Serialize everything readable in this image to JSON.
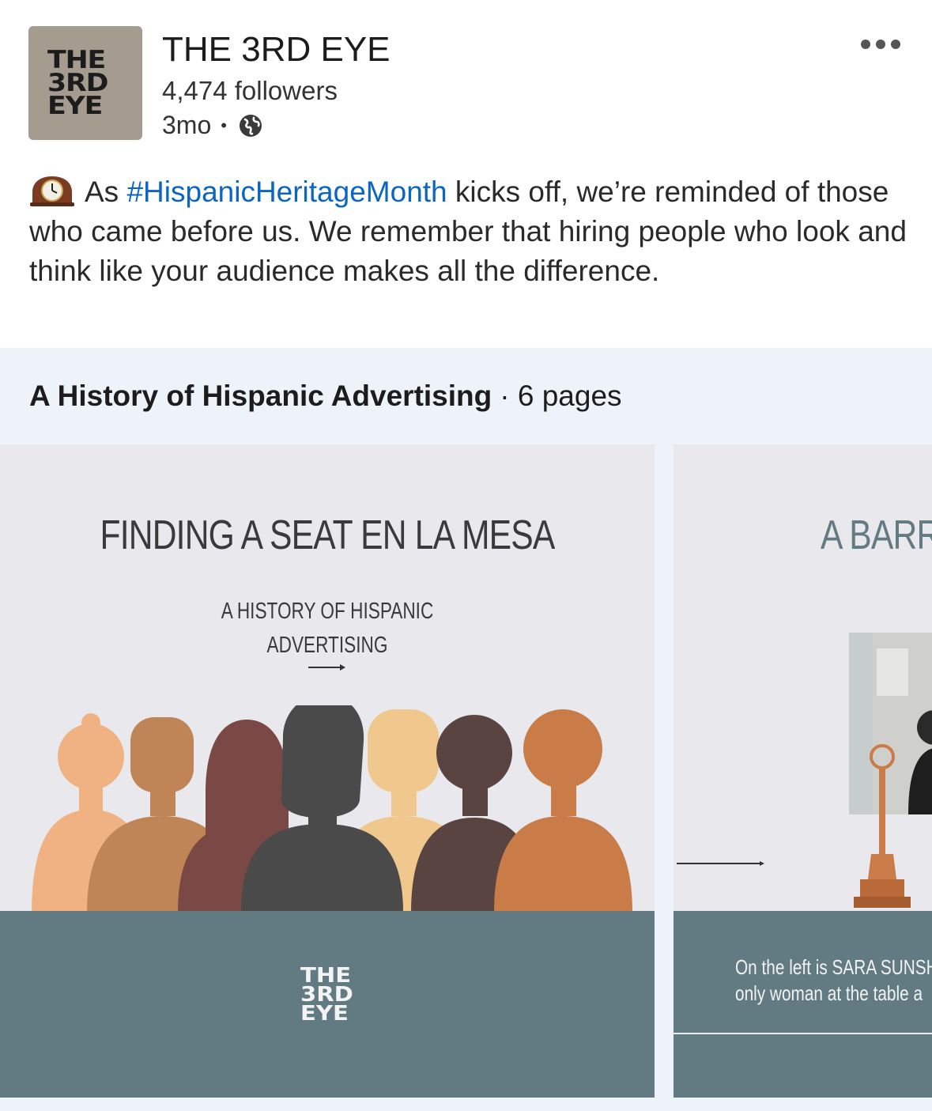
{
  "post": {
    "company_logo_lines": [
      "THE",
      "3RD",
      "EYE"
    ],
    "company_name": "THE 3RD EYE",
    "followers": "4,474 followers",
    "age": "3mo",
    "dot": "•",
    "visibility_icon": "globe-icon",
    "more_icon": "more-options-icon",
    "text_emoji": "mantelpiece-clock-emoji",
    "text_before": "As ",
    "hashtag": "#HispanicHeritageMonth",
    "text_after": " kicks off, we’re reminded of those who came before us. We remember that hiring people who look and think like your audience makes all the difference."
  },
  "document": {
    "title": "A History of Hispanic Advertising",
    "pages": "· 6 pages",
    "slides": [
      {
        "title": "FINDING A SEAT EN LA MESA",
        "subtitle_lines": [
          "A HISTORY OF HISPANIC",
          "ADVERTISING"
        ],
        "logo_lines": [
          "THE",
          "3RD",
          "EYE"
        ]
      },
      {
        "title": "A BARR",
        "caption_lines": [
          "On the left is SARA SUNSH",
          "only woman at the table a"
        ]
      }
    ]
  },
  "colors": {
    "hashtag": "#0a66c2",
    "logo_bg": "#a59c8f",
    "doc_bg": "#edf3f8",
    "slide_bg": "#e9e9ed",
    "slide_band": "#627a81",
    "silhouettes": [
      "#f0b283",
      "#c08556",
      "#7a4845",
      "#4a4a4a",
      "#f0c88d",
      "#5a4442",
      "#c97b48"
    ]
  }
}
